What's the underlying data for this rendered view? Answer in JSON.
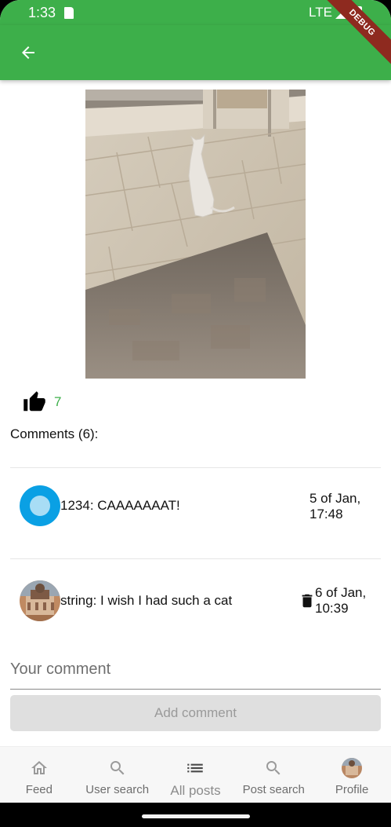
{
  "status_bar": {
    "time": "1:33",
    "network": "LTE"
  },
  "debug_banner": "DEBUG",
  "post": {
    "likes": "7"
  },
  "comments_heading": "Comments (6):",
  "comments": [
    {
      "text": "1234: CAAAAAAAT!",
      "date_line1": "5 of Jan,",
      "date_line2": "17:48"
    },
    {
      "text": "string: I wish I had such a cat",
      "date_line1": "6 of Jan,",
      "date_line2": "10:39"
    }
  ],
  "comment_input": {
    "placeholder": "Your comment",
    "value": ""
  },
  "add_comment_label": "Add comment",
  "bottom_nav": [
    {
      "label": "Feed",
      "icon": "home-icon"
    },
    {
      "label": "User search",
      "icon": "search-icon"
    },
    {
      "label": "All posts",
      "icon": "list-icon",
      "active": true
    },
    {
      "label": "Post search",
      "icon": "search-icon"
    },
    {
      "label": "Profile",
      "icon": "avatar"
    }
  ],
  "colors": {
    "primary": "#3daf4a",
    "avatar_blue": "#0aa0e4",
    "debug_banner": "#8e2a1f"
  }
}
